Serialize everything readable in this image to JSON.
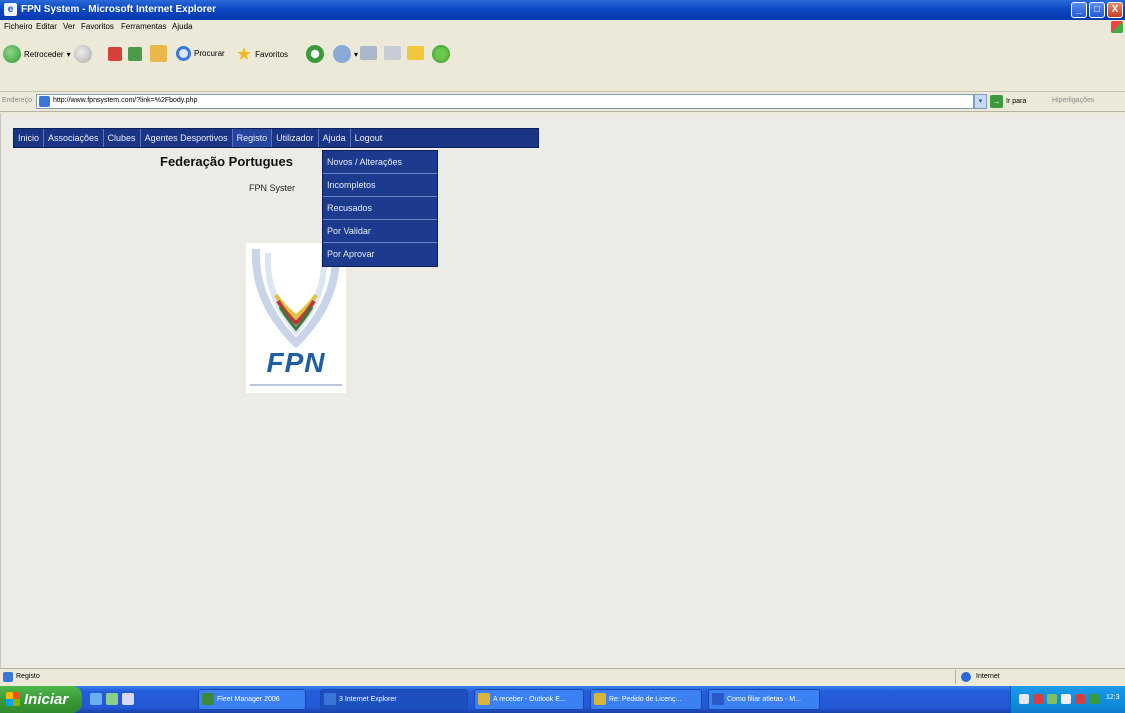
{
  "window": {
    "title": "FPN System - Microsoft Internet Explorer",
    "minimize_glyph": "_",
    "maximize_glyph": "□",
    "close_glyph": "X"
  },
  "menubar": {
    "items": [
      "Ficheiro",
      "Editar",
      "Ver",
      "Favoritos",
      "Ferramentas",
      "Ajuda"
    ]
  },
  "toolbar": {
    "back_label": "Retroceder",
    "search_label": "Procurar",
    "favorites_label": "Favoritos"
  },
  "address": {
    "label": "Endereço",
    "url": "http://www.fpnsystem.com/?link=%2Fbody.php",
    "go_label": "Ir para",
    "links_label": "Hiperligações"
  },
  "nav": {
    "items": [
      "Inicio",
      "Associações",
      "Clubes",
      "Agentes Desportivos",
      "Registo",
      "Utilizador",
      "Ajuda",
      "Logout"
    ],
    "active_index": 4
  },
  "dropdown": {
    "items": [
      "Novos / Alterações",
      "Incompletos",
      "Recusados",
      "Por Validar",
      "Por Aprovar"
    ]
  },
  "page": {
    "heading": "Federação Portugues",
    "subtitle": "FPN Syster",
    "logo_text": "FPN"
  },
  "statusbar": {
    "status_text": "Registo",
    "zone_text": "Internet"
  },
  "taskbar": {
    "start_label": "Iniciar",
    "tasks": [
      {
        "label": "Fleet Manager 2006",
        "icon_color": "#3a8a3a",
        "active": false
      },
      {
        "label": "3 Internet Explorer",
        "icon_color": "#3a76d8",
        "active": true
      },
      {
        "label": "A receber - Outlook E...",
        "icon_color": "#d8b43a",
        "active": false
      },
      {
        "label": "Re: Pedido de Licenç...",
        "icon_color": "#d8b43a",
        "active": false
      },
      {
        "label": "Como filiar atletas - M...",
        "icon_color": "#2a5ac8",
        "active": false
      }
    ],
    "clock": "12:3"
  },
  "colors": {
    "nav_bg": "#1b3585",
    "dropdown_bg": "#1c3a8e",
    "titlebar": "#0a47c4",
    "taskbar": "#245ddb",
    "logo_blue": "#1f5da4"
  }
}
